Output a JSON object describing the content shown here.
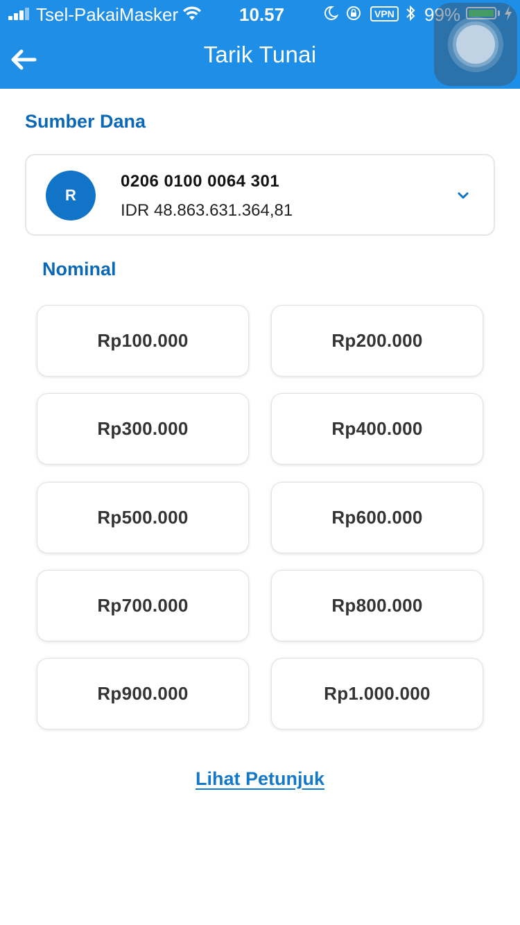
{
  "status_bar": {
    "carrier": "Tsel-PakaiMasker",
    "time": "10.57",
    "vpn_label": "VPN",
    "battery_percent_label": "99%",
    "battery_level": 0.99,
    "battery_color": "#4cd964"
  },
  "header": {
    "title": "Tarik Tunai",
    "back_icon": "arrow-left-icon",
    "background_color": "#1e8ee6"
  },
  "source": {
    "label": "Sumber Dana",
    "account": {
      "avatar_initial": "R",
      "number": "0206 0100 0064 301",
      "balance": "IDR 48.863.631.364,81"
    },
    "expand_icon": "chevron-down-icon"
  },
  "nominal": {
    "label": "Nominal",
    "options": [
      "Rp100.000",
      "Rp200.000",
      "Rp300.000",
      "Rp400.000",
      "Rp500.000",
      "Rp600.000",
      "Rp700.000",
      "Rp800.000",
      "Rp900.000",
      "Rp1.000.000"
    ]
  },
  "guide_link": "Lihat Petunjuk",
  "colors": {
    "accent": "#1e8ee6",
    "label": "#0a68b6",
    "avatar": "#1274c6",
    "link": "#1478c8"
  }
}
